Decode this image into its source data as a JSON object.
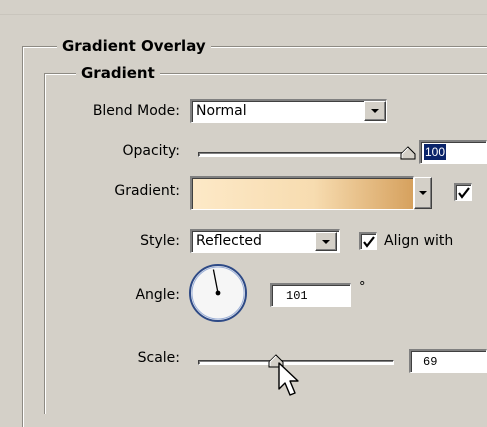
{
  "panel": {
    "section_title": "Gradient Overlay",
    "group_title": "Gradient"
  },
  "blend_mode": {
    "label": "Blend Mode:",
    "value": "Normal"
  },
  "opacity": {
    "label": "Opacity:",
    "value": "100",
    "fraction": 1.0
  },
  "gradient": {
    "label": "Gradient:",
    "colors": [
      "#fde9c7",
      "#f7dcb0",
      "#d6a15e"
    ],
    "reverse_checked": true
  },
  "style": {
    "label": "Style:",
    "value": "Reflected",
    "align_label": "Align with",
    "align_checked": true
  },
  "angle": {
    "label": "Angle:",
    "value": "101",
    "unit": "°",
    "degrees": 101
  },
  "scale": {
    "label": "Scale:",
    "value": "69",
    "fraction": 0.4
  },
  "colors": {
    "panel_bg": "#d4d0c8",
    "selection": "#0a246a",
    "dial_bg": "#f6f6f6"
  }
}
